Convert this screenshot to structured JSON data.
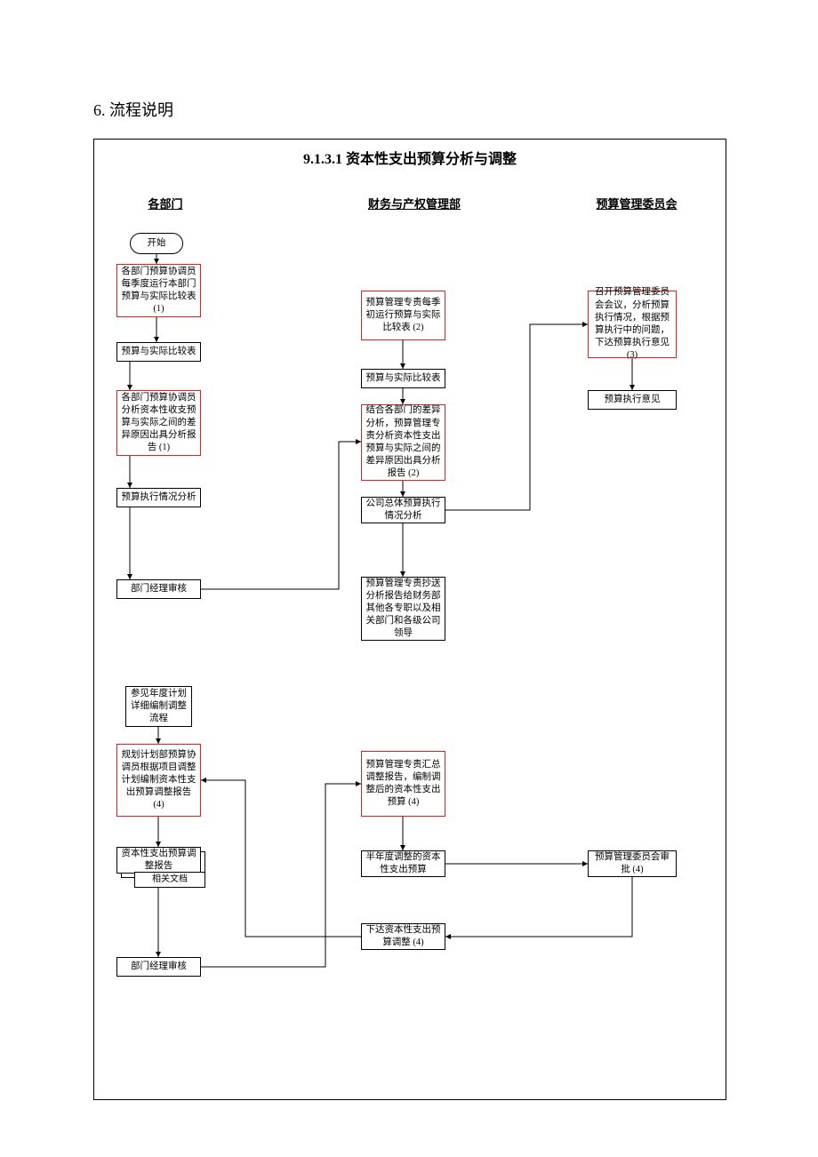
{
  "section_title": "6. 流程说明",
  "diagram_title": "9.1.3.1 资本性支出预算分析与调整",
  "lanes": {
    "dept": "各部门",
    "finance": "财务与产权管理部",
    "committee": "预算管理委员会"
  },
  "nodes": {
    "start": "开始",
    "dept_qtr": "各部门预算协调员每季度运行本部门预算与实际比较表\n(1)",
    "dept_cmp": "预算与实际比较表",
    "dept_var": "各部门预算协调员分析资本性收支预算与实际之间的差异原因出具分析报告\n(1)",
    "dept_exec": "预算执行情况分析",
    "dept_mgr": "部门经理审核",
    "ref_annual": "参见年度计划详细编制调整流程",
    "plan_adj": "规划计划部预算协调员根据项目调整计划编制资本性支出预算调整报告\n(4)",
    "cap_adj_rpt": "资本性支出预算调整报告",
    "rel_docs": "相关文档",
    "dept_mgr2": "部门经理审核",
    "fin_qtr": "预算管理专责每季初运行预算与实际比较表\n(2)",
    "fin_cmp": "预算与实际比较表",
    "fin_var": "结合各部门的差异分析，预算管理专责分析资本性支出预算与实际之间的差异原因出具分析报告\n(2)",
    "co_exec": "公司总体预算执行情况分析",
    "send_rpt": "预算管理专责抄送分析报告给财务部其他各专职以及相关部门和各级公司领导",
    "fin_sum": "预算管理专责汇总调整报告，编制调整后的资本性支出预算\n(4)",
    "half_adj": "半年度调整的资本性支出预算",
    "issue_adj": "下达资本性支出预算调整\n(4)",
    "com_meet": "召开预算管理委员会会议，分析预算执行情况，根据预算执行中的问题，下达预算执行意见\n(3)",
    "exec_op": "预算执行意见",
    "com_appr": "预算管理委员会审批\n(4)"
  },
  "chart_data": {
    "type": "flowchart",
    "title": "9.1.3.1 资本性支出预算分析与调整",
    "swimlanes": [
      "各部门",
      "财务与产权管理部",
      "预算管理委员会"
    ],
    "nodes": [
      {
        "id": "start",
        "lane": 0,
        "label": "开始",
        "shape": "terminator"
      },
      {
        "id": "dept_qtr",
        "lane": 0,
        "label": "各部门预算协调员每季度运行本部门预算与实际比较表(1)",
        "shape": "process",
        "highlight": true
      },
      {
        "id": "dept_cmp",
        "lane": 0,
        "label": "预算与实际比较表",
        "shape": "process"
      },
      {
        "id": "dept_var",
        "lane": 0,
        "label": "各部门预算协调员分析资本性收支预算与实际之间的差异原因出具分析报告(1)",
        "shape": "process",
        "highlight": true
      },
      {
        "id": "dept_exec",
        "lane": 0,
        "label": "预算执行情况分析",
        "shape": "process"
      },
      {
        "id": "dept_mgr",
        "lane": 0,
        "label": "部门经理审核",
        "shape": "process"
      },
      {
        "id": "ref_annual",
        "lane": 0,
        "label": "参见年度计划详细编制调整流程",
        "shape": "process"
      },
      {
        "id": "plan_adj",
        "lane": 0,
        "label": "规划计划部预算协调员根据项目调整计划编制资本性支出预算调整报告(4)",
        "shape": "process",
        "highlight": true
      },
      {
        "id": "cap_adj_rpt",
        "lane": 0,
        "label": "资本性支出预算调整报告",
        "shape": "document"
      },
      {
        "id": "rel_docs",
        "lane": 0,
        "label": "相关文档",
        "shape": "document"
      },
      {
        "id": "dept_mgr2",
        "lane": 0,
        "label": "部门经理审核",
        "shape": "process"
      },
      {
        "id": "fin_qtr",
        "lane": 1,
        "label": "预算管理专责每季初运行预算与实际比较表(2)",
        "shape": "process",
        "highlight": true
      },
      {
        "id": "fin_cmp",
        "lane": 1,
        "label": "预算与实际比较表",
        "shape": "process"
      },
      {
        "id": "fin_var",
        "lane": 1,
        "label": "结合各部门的差异分析，预算管理专责分析资本性支出预算与实际之间的差异原因出具分析报告(2)",
        "shape": "process",
        "highlight": true
      },
      {
        "id": "co_exec",
        "lane": 1,
        "label": "公司总体预算执行情况分析",
        "shape": "process"
      },
      {
        "id": "send_rpt",
        "lane": 1,
        "label": "预算管理专责抄送分析报告给财务部其他各专职以及相关部门和各级公司领导",
        "shape": "process"
      },
      {
        "id": "fin_sum",
        "lane": 1,
        "label": "预算管理专责汇总调整报告，编制调整后的资本性支出预算(4)",
        "shape": "process",
        "highlight": true
      },
      {
        "id": "half_adj",
        "lane": 1,
        "label": "半年度调整的资本性支出预算",
        "shape": "process"
      },
      {
        "id": "issue_adj",
        "lane": 1,
        "label": "下达资本性支出预算调整(4)",
        "shape": "process"
      },
      {
        "id": "com_meet",
        "lane": 2,
        "label": "召开预算管理委员会会议，分析预算执行情况，根据预算执行中的问题，下达预算执行意见(3)",
        "shape": "process",
        "highlight": true
      },
      {
        "id": "exec_op",
        "lane": 2,
        "label": "预算执行意见",
        "shape": "process"
      },
      {
        "id": "com_appr",
        "lane": 2,
        "label": "预算管理委员会审批(4)",
        "shape": "process"
      }
    ],
    "edges": [
      {
        "from": "start",
        "to": "dept_qtr"
      },
      {
        "from": "dept_qtr",
        "to": "dept_cmp"
      },
      {
        "from": "dept_cmp",
        "to": "dept_var"
      },
      {
        "from": "dept_var",
        "to": "dept_exec"
      },
      {
        "from": "dept_exec",
        "to": "dept_mgr"
      },
      {
        "from": "dept_mgr",
        "to": "fin_var"
      },
      {
        "from": "fin_qtr",
        "to": "fin_cmp"
      },
      {
        "from": "fin_cmp",
        "to": "fin_var"
      },
      {
        "from": "fin_var",
        "to": "co_exec"
      },
      {
        "from": "co_exec",
        "to": "send_rpt"
      },
      {
        "from": "co_exec",
        "to": "com_meet"
      },
      {
        "from": "com_meet",
        "to": "exec_op"
      },
      {
        "from": "ref_annual",
        "to": "plan_adj"
      },
      {
        "from": "plan_adj",
        "to": "cap_adj_rpt"
      },
      {
        "from": "cap_adj_rpt",
        "to": "dept_mgr2"
      },
      {
        "from": "dept_mgr2",
        "to": "fin_sum"
      },
      {
        "from": "fin_sum",
        "to": "half_adj"
      },
      {
        "from": "half_adj",
        "to": "com_appr"
      },
      {
        "from": "com_appr",
        "to": "issue_adj"
      },
      {
        "from": "issue_adj",
        "to": "plan_adj"
      }
    ]
  }
}
